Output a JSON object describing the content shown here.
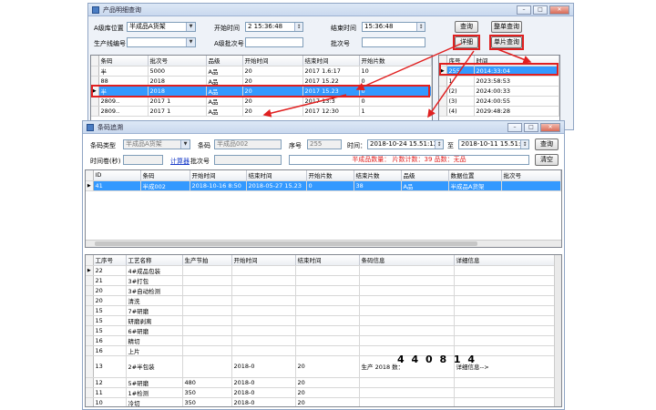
{
  "back_window": {
    "title": "产品明细查询",
    "controls": {
      "warehouse_label": "A级库位置",
      "warehouse_value": "半成品A货架",
      "start_label": "开始时间",
      "start_value": "2 15:36:48",
      "end_label": "结束时间",
      "end_value": "15:36:48",
      "query_button": "查询",
      "dept_label": "生产线编号",
      "serial_label": "A级批次号",
      "batch_label": "批次号",
      "detail_button": "详细",
      "other_query_button": "整单查询",
      "partial_query_button": "单片查询"
    },
    "main_table": {
      "headers": [
        "条码",
        "批次号",
        "品级",
        "开始时间",
        "结束时间",
        "开始片数"
      ],
      "rows": [
        [
          "半",
          "5000",
          "A品",
          "20",
          "2017 1.6:17",
          "10"
        ],
        [
          "88",
          "2018",
          "A品",
          "20",
          "2017 15.22",
          "0"
        ],
        [
          "半",
          "2018",
          "A品",
          "20",
          "2017 15.23",
          "0"
        ],
        [
          "2809..",
          "2017 1",
          "A品",
          "20",
          "2017 13:3",
          "0"
        ],
        [
          "2809..",
          "2017 1",
          "A品",
          "20",
          "2017 12:30",
          "1"
        ]
      ]
    },
    "side_table": {
      "headers": [
        "序号",
        "时间"
      ],
      "rows": [
        [
          "255",
          "2014:33:04"
        ],
        [
          "1",
          "2023:58:53"
        ],
        [
          "(2)",
          "2024:00:33"
        ],
        [
          "(3)",
          "2024:00:55"
        ],
        [
          "(4)",
          "2029:48:28"
        ]
      ]
    }
  },
  "front_window": {
    "title": "条码追溯",
    "controls": {
      "type_label": "条码类型",
      "type_value": "半成品A货架",
      "barcode_label": "条码",
      "barcode_value": "半成品002",
      "seq_label": "序号",
      "seq_value": "255",
      "time_label": "时间：",
      "time_from": "2018-10-24 15.51:12",
      "to_label": "至",
      "time_to": "2018-10-11 15.51:12",
      "query_button": "查询",
      "shift_label": "时间卷(秒)",
      "calc_link": "计算器",
      "batch_label": "批次号",
      "summary_text": "半成品数量：  片数计数：39  品数：无品",
      "clear_button": "清空"
    },
    "upper_table": {
      "headers": [
        "ID",
        "条码",
        "开始时间",
        "结束时间",
        "开始片数",
        "结束片数",
        "品级",
        "数据位置",
        "批次号"
      ],
      "rows": [
        [
          "41",
          "半成002",
          "2018-10-16 8:50",
          "2018-05-27 15.23",
          "0",
          "38",
          "A品",
          "半成品A货架",
          ""
        ]
      ]
    },
    "lower_table": {
      "headers": [
        "工序号",
        "工艺名称",
        "生产节拍",
        "开始时间",
        "结束时间",
        "条码信息",
        "详细信息"
      ],
      "rows": [
        [
          "22",
          "4#成品包装",
          "",
          "",
          "",
          "",
          ""
        ],
        [
          "21",
          "3#打包",
          "",
          "",
          "",
          "",
          ""
        ],
        [
          "20",
          "3#自动检测",
          "",
          "",
          "",
          "",
          ""
        ],
        [
          "20",
          "清洗",
          "",
          "",
          "",
          "",
          ""
        ],
        [
          "15",
          "7#研磨",
          "",
          "",
          "",
          "",
          ""
        ],
        [
          "15",
          "研磨剥离",
          "",
          "",
          "",
          "",
          ""
        ],
        [
          "15",
          "6#研磨",
          "",
          "",
          "",
          "",
          ""
        ],
        [
          "16",
          "精切",
          "",
          "",
          "",
          "",
          ""
        ],
        [
          "16",
          "上片",
          "",
          "",
          "",
          "",
          ""
        ],
        [
          "13",
          "2#半包装",
          "",
          "2018-0",
          "20",
          "生产 2018 数：",
          "详细信息-->"
        ],
        [
          "12",
          "5#研磨",
          "480",
          "2018-0",
          "20",
          "",
          ""
        ],
        [
          "11",
          "1#检测",
          "350",
          "2018-0",
          "20",
          "",
          ""
        ],
        [
          "10",
          "冷切",
          "350",
          "2018-0",
          "20",
          "",
          ""
        ]
      ],
      "big_code": "4 4 0 8 1 4"
    }
  },
  "colors": {
    "selection": "#3399ff",
    "highlight_red": "#e02020"
  }
}
